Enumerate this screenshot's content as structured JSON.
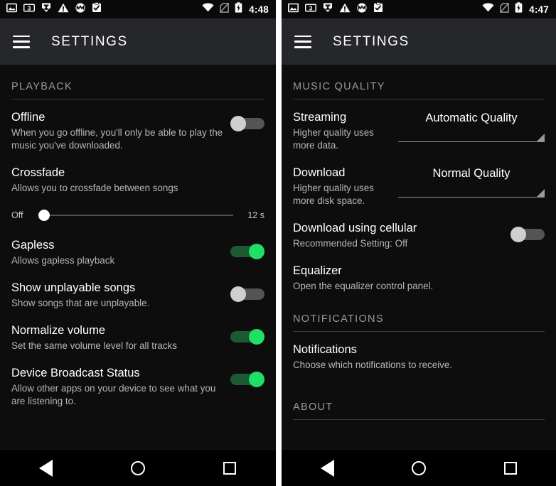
{
  "left": {
    "statusbar": {
      "time": "4:48",
      "left_icons": [
        "photo-icon",
        "counter-3-icon",
        "do-not-disturb-icon",
        "warning-icon",
        "motorola-icon",
        "clipboard-check-icon"
      ],
      "right_icons": [
        "wifi-icon",
        "no-sim-icon",
        "battery-charging-icon"
      ]
    },
    "appbar": {
      "title": "SETTINGS",
      "menu_icon": "hamburger-menu-icon"
    },
    "section_header": "PLAYBACK",
    "rows": [
      {
        "title": "Offline",
        "subtitle": "When you go offline, you'll only be able to play the music you've downloaded.",
        "control": "toggle",
        "state": "off"
      },
      {
        "title": "Crossfade",
        "subtitle": "Allows you to crossfade between songs",
        "control": "none"
      },
      {
        "title": "Gapless",
        "subtitle": "Allows gapless playback",
        "control": "toggle",
        "state": "on"
      },
      {
        "title": "Show unplayable songs",
        "subtitle": "Show songs that are unplayable.",
        "control": "toggle",
        "state": "off"
      },
      {
        "title": "Normalize volume",
        "subtitle": "Set the same volume level for all tracks",
        "control": "toggle",
        "state": "on"
      },
      {
        "title": "Device Broadcast Status",
        "subtitle": "Allow other apps on your device to see what you are listening to.",
        "control": "toggle",
        "state": "on"
      }
    ],
    "crossfade_slider": {
      "min_label": "Off",
      "max_label": "12 s",
      "value_percent": 0
    }
  },
  "right": {
    "statusbar": {
      "time": "4:47",
      "left_icons": [
        "photo-icon",
        "counter-3-icon",
        "do-not-disturb-icon",
        "warning-icon",
        "motorola-icon",
        "clipboard-check-icon"
      ],
      "right_icons": [
        "wifi-icon",
        "no-sim-icon",
        "battery-charging-icon"
      ]
    },
    "appbar": {
      "title": "SETTINGS",
      "menu_icon": "hamburger-menu-icon"
    },
    "sections": [
      {
        "header": "MUSIC QUALITY"
      },
      {
        "header": "NOTIFICATIONS"
      },
      {
        "header": "ABOUT"
      }
    ],
    "rows": [
      {
        "title": "Streaming",
        "subtitle": "Higher quality uses more data.",
        "control": "spinner",
        "value": "Automatic Quality"
      },
      {
        "title": "Download",
        "subtitle": "Higher quality uses more disk space.",
        "control": "spinner",
        "value": "Normal Quality"
      },
      {
        "title": "Download using cellular",
        "subtitle": "Recommended Setting: Off",
        "control": "toggle",
        "state": "off"
      },
      {
        "title": "Equalizer",
        "subtitle": "Open the equalizer control panel.",
        "control": "none"
      },
      {
        "title": "Notifications",
        "subtitle": "Choose which notifications to receive.",
        "control": "none"
      }
    ]
  },
  "navbar": {
    "back_label": "back-icon",
    "home_label": "home-icon",
    "recents_label": "recents-icon"
  },
  "colors": {
    "accent_green": "#1fdf64",
    "track_green": "#1b5a33",
    "background": "#0d0d0d",
    "appbar": "#26272b",
    "toggle_off_thumb": "#cfcfcf",
    "toggle_off_track": "#545454"
  }
}
